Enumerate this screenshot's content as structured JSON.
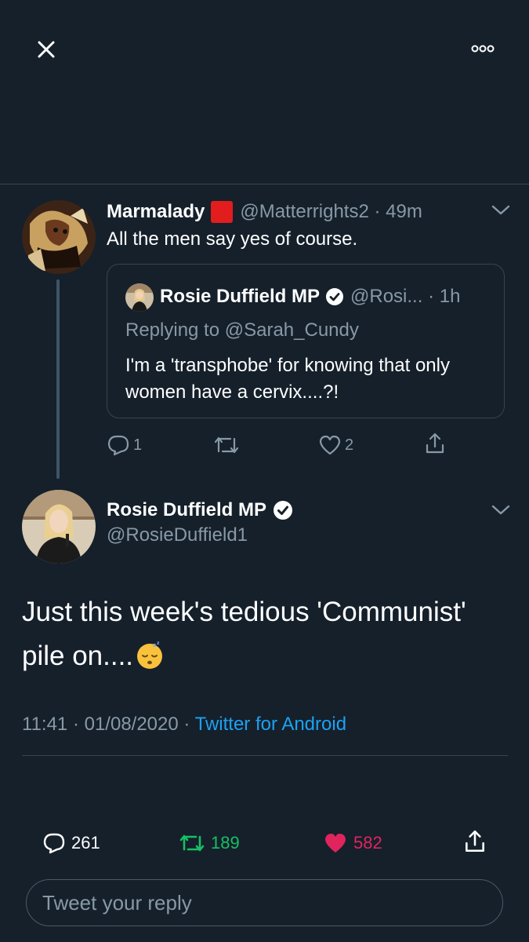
{
  "top_bar": {
    "close_icon": "close-icon",
    "more_icon": "more-horizontal-icon"
  },
  "parent_tweet": {
    "name": "Marmalady",
    "handle_time": "@Matterrights2 · 49m",
    "text": "All the men say yes of course.",
    "replies": "1",
    "retweets": "",
    "likes": "2",
    "quote": {
      "name": "Rosie Duffield MP",
      "handle_time": "@Rosi... · 1h",
      "replying_to": "Replying to @Sarah_Cundy",
      "text": "I'm a 'transphobe' for knowing that only women have a cervix....?!"
    }
  },
  "main_tweet": {
    "name": "Rosie Duffield MP",
    "handle": "@RosieDuffield1",
    "text": "Just this week's tedious 'Communist' pile on....",
    "emoji": "sleeping-face",
    "timestamp": "11:41 · 01/08/2020 · ",
    "client": "Twitter for Android",
    "replies": "261",
    "retweets": "189",
    "likes": "582"
  },
  "reply_input": {
    "placeholder": "Tweet your reply"
  },
  "colors": {
    "background": "#15202b",
    "muted": "#8899a6",
    "link": "#1da1f2",
    "retweet": "#17bf63",
    "like": "#e0245e",
    "divider": "#38444d"
  }
}
